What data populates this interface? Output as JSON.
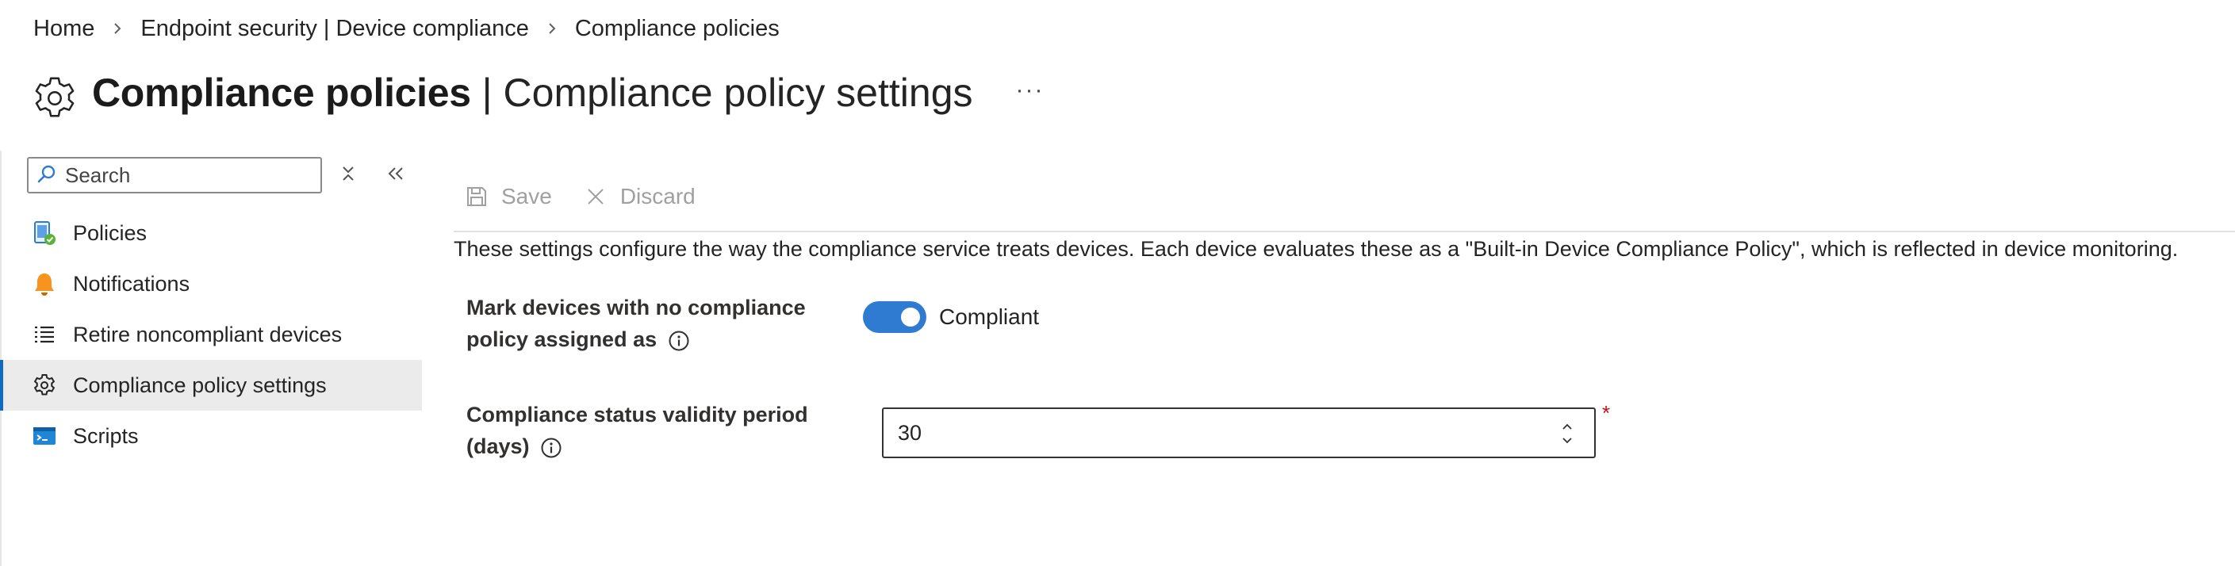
{
  "breadcrumb": {
    "items": [
      "Home",
      "Endpoint security | Device compliance",
      "Compliance policies"
    ]
  },
  "header": {
    "title_main": "Compliance policies",
    "title_sub": " | Compliance policy settings",
    "more_label": "···",
    "icon": "gear-icon"
  },
  "sidebar": {
    "search_placeholder": "Search",
    "items": [
      {
        "label": "Policies",
        "icon": "policy-device-icon"
      },
      {
        "label": "Notifications",
        "icon": "bell-icon"
      },
      {
        "label": "Retire noncompliant devices",
        "icon": "list-icon"
      },
      {
        "label": "Compliance policy settings",
        "icon": "gear-icon",
        "active": true
      },
      {
        "label": "Scripts",
        "icon": "script-console-icon"
      }
    ]
  },
  "toolbar": {
    "save_label": "Save",
    "discard_label": "Discard"
  },
  "main": {
    "description": "These settings configure the way the compliance service treats devices. Each device evaluates these as a \"Built-in Device Compliance Policy\", which is reflected in device monitoring.",
    "fields": {
      "no_policy_label_line1": "Mark devices with no compliance",
      "no_policy_label_line2": "policy assigned as",
      "no_policy_value": "Compliant",
      "validity_label_line1": "Compliance status validity period",
      "validity_label_line2": "(days)",
      "validity_value": "30",
      "required_mark": "*"
    }
  },
  "colors": {
    "accent": "#0f6cbd",
    "toggle_on": "#2f7bd2",
    "required": "#c50f1f",
    "active_bg": "#ebebeb"
  }
}
